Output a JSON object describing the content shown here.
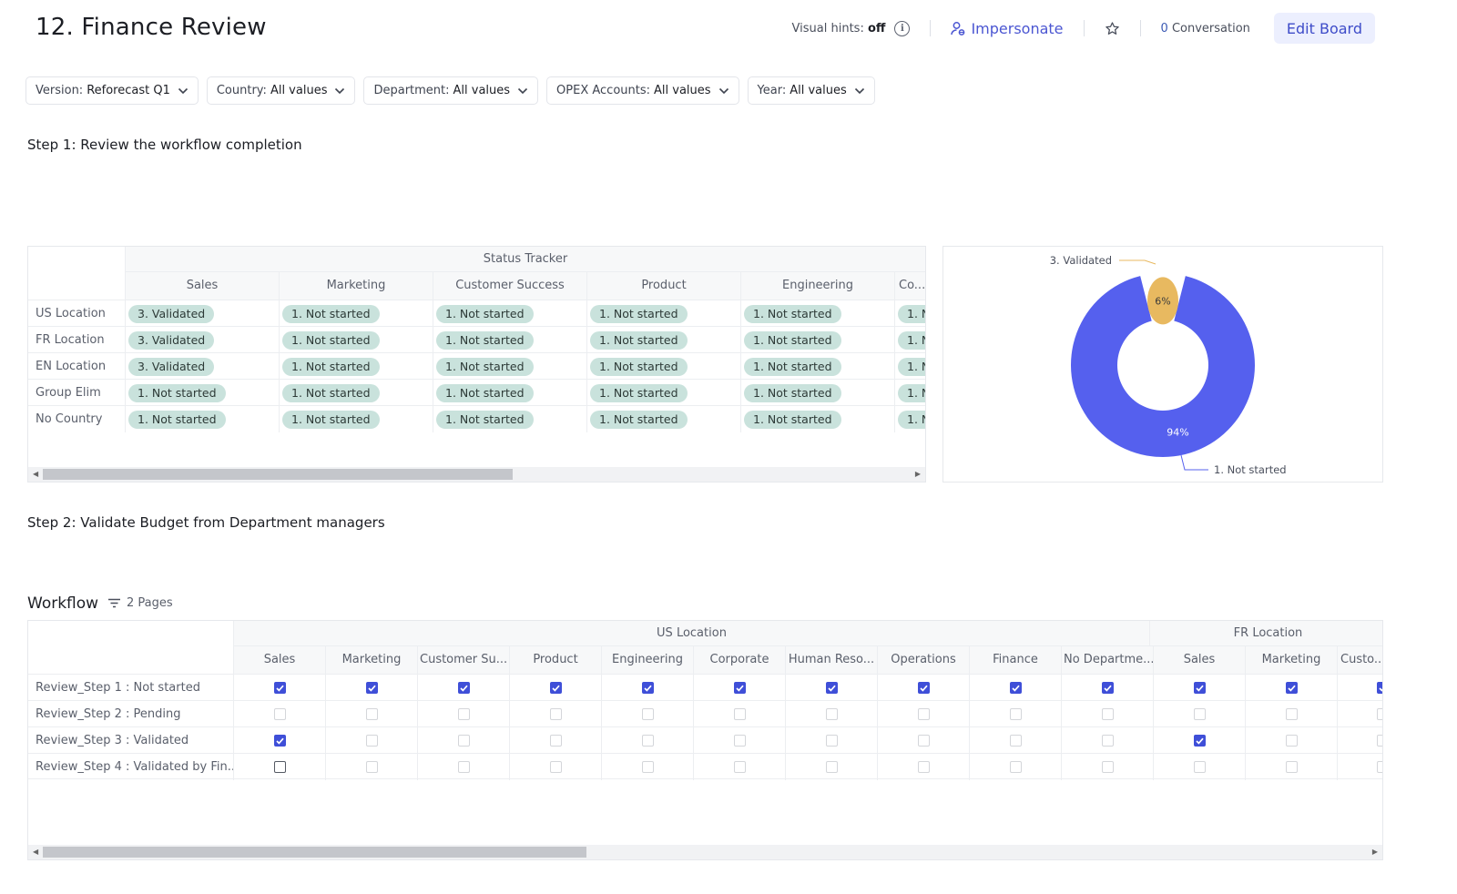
{
  "page": {
    "title": "12. Finance Review"
  },
  "header": {
    "hints_label": "Visual hints:",
    "hints_value": "off",
    "impersonate": "Impersonate",
    "conversation_count": "0",
    "conversation_label": "Conversation",
    "edit_board": "Edit Board"
  },
  "filters": [
    {
      "label": "Version:",
      "value": "Reforecast Q1"
    },
    {
      "label": "Country:",
      "value": "All values"
    },
    {
      "label": "Department:",
      "value": "All values"
    },
    {
      "label": "OPEX Accounts:",
      "value": "All values"
    },
    {
      "label": "Year:",
      "value": "All values"
    }
  ],
  "step1": {
    "title": "Step 1: Review the workflow completion"
  },
  "tracker": {
    "title": "Status Tracker",
    "columns": [
      "Sales",
      "Marketing",
      "Customer Success",
      "Product",
      "Engineering",
      "Co..."
    ],
    "rows": [
      {
        "label": "US Location",
        "cells": [
          "3. Validated",
          "1. Not started",
          "1. Not started",
          "1. Not started",
          "1. Not started",
          "1. N"
        ]
      },
      {
        "label": "FR Location",
        "cells": [
          "3. Validated",
          "1. Not started",
          "1. Not started",
          "1. Not started",
          "1. Not started",
          "1. N"
        ]
      },
      {
        "label": "EN Location",
        "cells": [
          "3. Validated",
          "1. Not started",
          "1. Not started",
          "1. Not started",
          "1. Not started",
          "1. N"
        ]
      },
      {
        "label": "Group Elim",
        "cells": [
          "1. Not started",
          "1. Not started",
          "1. Not started",
          "1. Not started",
          "1. Not started",
          "1. N"
        ]
      },
      {
        "label": "No Country",
        "cells": [
          "1. Not started",
          "1. Not started",
          "1. Not started",
          "1. Not started",
          "1. Not started",
          "1. N"
        ]
      }
    ],
    "scroll_fraction": 0.54
  },
  "chart_data": {
    "type": "pie",
    "categories": [
      "3. Validated",
      "1. Not started"
    ],
    "values": [
      6,
      94
    ],
    "value_labels": [
      "6%",
      "94%"
    ],
    "colors": [
      "#e8b960",
      "#5560ee"
    ],
    "donut": true
  },
  "step2": {
    "title": "Step 2: Validate Budget from Department managers"
  },
  "workflow": {
    "title": "Workflow",
    "pages": "2 Pages",
    "groups": [
      "US Location",
      "FR Location"
    ],
    "columns": [
      "Sales",
      "Marketing",
      "Customer Su...",
      "Product",
      "Engineering",
      "Corporate",
      "Human Reso...",
      "Operations",
      "Finance",
      "No Departme...",
      "Sales",
      "Marketing",
      "Custo..."
    ],
    "rows": [
      {
        "label": "Review_Step 1 : Not started",
        "checks": [
          1,
          1,
          1,
          1,
          1,
          1,
          1,
          1,
          1,
          1,
          1,
          1,
          1
        ]
      },
      {
        "label": "Review_Step 2 : Pending",
        "checks": [
          0,
          0,
          0,
          0,
          0,
          0,
          0,
          0,
          0,
          0,
          0,
          0,
          0
        ]
      },
      {
        "label": "Review_Step 3 : Validated",
        "checks": [
          1,
          0,
          0,
          0,
          0,
          0,
          0,
          0,
          0,
          0,
          1,
          0,
          0
        ]
      },
      {
        "label": "Review_Step 4 : Validated by Fin...",
        "checks": [
          0,
          0,
          0,
          0,
          0,
          0,
          0,
          0,
          0,
          0,
          0,
          0,
          0
        ]
      }
    ],
    "scroll_fraction": 0.41
  }
}
